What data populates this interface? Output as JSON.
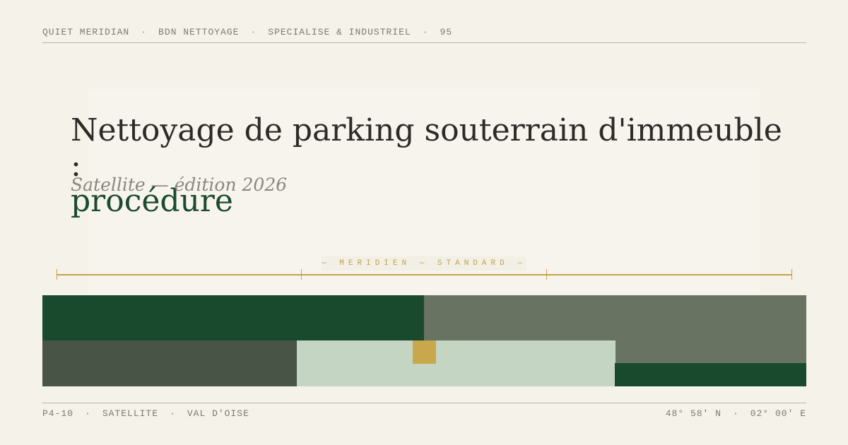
{
  "header": {
    "items": [
      "QUIET MERIDIAN",
      "BDN NETTOYAGE",
      "SPECIALISE & INDUSTRIEL",
      "95"
    ],
    "separator": "·"
  },
  "title": {
    "main": "Nettoyage de parking souterrain d'immeuble :",
    "accent": "procédure"
  },
  "subtitle": "Satellite — édition 2026",
  "scale": {
    "label": "— MERIDIEN — STANDARD —"
  },
  "footer": {
    "left": [
      "P4-10",
      "SATELLITE",
      "VAL D'OISE"
    ],
    "right": [
      "48° 58′ N",
      "02° 00′ E"
    ],
    "separator": "·"
  },
  "colors": {
    "background": "#f5f2ea",
    "forest_green": "#1a4a2e",
    "sage_gray": "#687362",
    "dark_sage": "#475446",
    "pale_sage": "#c5d5c3",
    "gold": "#c9a74d"
  }
}
